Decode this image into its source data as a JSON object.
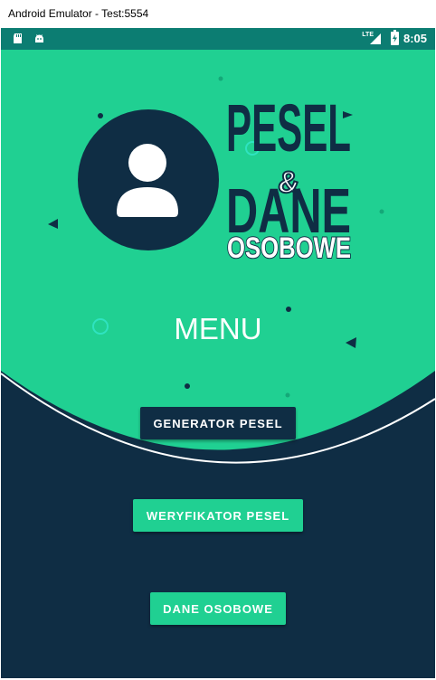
{
  "window": {
    "title": "Android Emulator - Test:5554"
  },
  "statusbar": {
    "time": "8:05",
    "network": "LTE",
    "left_icons": [
      "sd-card-icon",
      "android-icon"
    ],
    "right_icons": [
      "signal-icon",
      "battery-icon"
    ]
  },
  "logo": {
    "line1": "PESEL",
    "line2": "&",
    "line3": "DANE",
    "line4": "OSOBOWE"
  },
  "menu": {
    "title": "MENU"
  },
  "buttons": {
    "generator": "GENERATOR PESEL",
    "weryfikator": "WERYFIKATOR PESEL",
    "dane": "DANE OSOBOWE"
  },
  "colors": {
    "primary_dark": "#0f2d44",
    "accent_green": "#20d092",
    "statusbar": "#0c7d72"
  }
}
